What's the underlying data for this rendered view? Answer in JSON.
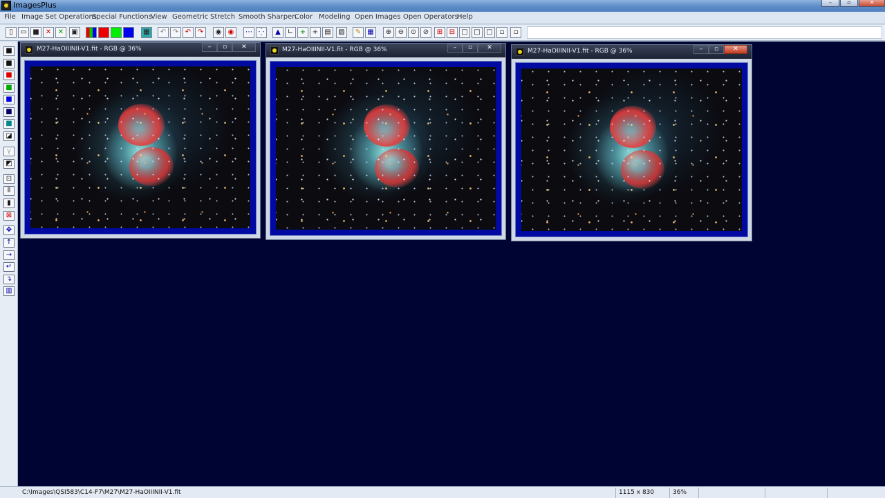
{
  "app": {
    "title": "ImagesPlus"
  },
  "menu": [
    "File",
    "Image Set Operations",
    "Special Functions",
    "View",
    "Geometric",
    "Stretch",
    "Smooth Sharpen",
    "Color",
    "Modeling",
    "Open Images",
    "Open Operators",
    "Help"
  ],
  "window_controls": {
    "minimize": "–",
    "restore": "▫",
    "close": "✕"
  },
  "image_windows": [
    {
      "title": "M27-HaOIIINII-V1.fit - RGB @ 36%",
      "active": false
    },
    {
      "title": "M27-HaOIIINII-V1.fit - RGB @ 36%",
      "active": false
    },
    {
      "title": "M27-HaOIIINII-V1.fit - RGB @ 36%",
      "active": true
    }
  ],
  "toolbar": {
    "icons": [
      "new-file-icon",
      "open-folder-icon",
      "save-icon",
      "close-red-icon",
      "close-green-icon",
      "copy-icon",
      "rgb-channels-icon",
      "red-channel-icon",
      "green-channel-icon",
      "blue-channel-icon",
      "grid-icon",
      "undo-icon",
      "redo-icon",
      "undo-all-icon",
      "redo-all-icon",
      "circle-select-icon",
      "circle-record-icon",
      "dots-line-icon",
      "star-point-icon",
      "histogram-icon",
      "levels-icon",
      "add-icon",
      "crosshair-icon",
      "calculator-icon",
      "image-adjust-icon",
      "pencil-icon",
      "table-icon",
      "zoom-in-icon",
      "zoom-out-icon",
      "zoom-fit-icon",
      "zoom-actual-icon",
      "plus-box-icon",
      "minus-box-icon",
      "frame-1-icon",
      "frame-2-icon",
      "frame-3-icon",
      "frame-4-icon",
      "frame-5-icon"
    ]
  },
  "leftbar": {
    "icons": [
      "save-icon",
      "black-square-icon",
      "red-square-icon",
      "green-square-icon",
      "blue-square-icon",
      "navy-square-icon",
      "teal-square-icon",
      "corner-square-icon",
      "gamma-icon",
      "diagonal-icon",
      "target-icon",
      "bars-icon",
      "black-bar-icon",
      "select-red-icon",
      "move-icon",
      "arrow-up-icon",
      "arrow-right-icon",
      "rotate-left-icon",
      "rotate-right-icon",
      "frame-icon"
    ]
  },
  "status": {
    "path": "C:\\Images\\QSI583\\C14-F7\\M27\\M27-HaOIIINII-V1.fit",
    "dimensions": "1115 x 830",
    "zoom": "36%"
  }
}
